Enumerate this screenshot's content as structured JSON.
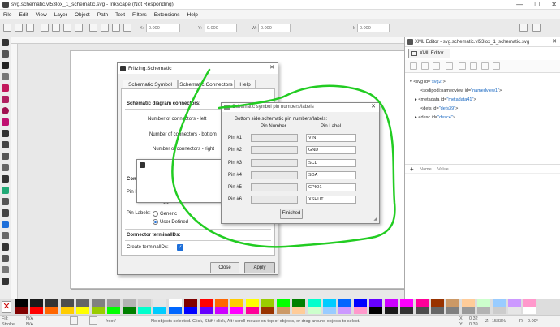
{
  "window": {
    "title": "svg.schematic.vl53lox_1_schematic.svg - Inkscape (Not Responding)",
    "controls": [
      "—",
      "☐",
      "✕"
    ]
  },
  "menu": [
    "File",
    "Edit",
    "View",
    "Layer",
    "Object",
    "Path",
    "Text",
    "Filters",
    "Extensions",
    "Help"
  ],
  "toolbar": {
    "x_label": "X:",
    "x_value": "0.000",
    "y_label": "Y:",
    "y_value": "0.000",
    "w_label": "W:",
    "w_value": "0.000",
    "h_label": "H:",
    "h_value": "0.000"
  },
  "xml_editor": {
    "window_title": "XML Editor - svg.schematic.vl53lox_1_schematic.svg",
    "tab_label": "XML Editor",
    "nodes": [
      {
        "prefix": "<svg id=",
        "value": "\"svg2\"",
        "suffix": ">"
      },
      {
        "prefix": "<sodipodi:namedview id=",
        "value": "\"namedview1\"",
        "suffix": ">"
      },
      {
        "prefix": "<metadata id=",
        "value": "\"metadata41\"",
        "suffix": ">"
      },
      {
        "prefix": "<defs id=",
        "value": "\"defs39\"",
        "suffix": ">"
      },
      {
        "prefix": "<desc id=",
        "value": "\"desc4\"",
        "suffix": ">"
      }
    ],
    "attr_add": "+",
    "attr_name_header": "Name",
    "attr_value_header": "Value"
  },
  "fritzing_dialog": {
    "title": "Fritzing:Schematic",
    "tabs": [
      "Schematic Symbol",
      "Schematic Connectors",
      "Help"
    ],
    "active_tab": 1,
    "section_connectors": "Schematic diagram connectors:",
    "num_left": "Number of connectors - left",
    "num_bottom": "Number of connectors - bottom",
    "num_right": "Number of connectors - right",
    "truncated_1": "Conn",
    "truncated_2": "Pin N",
    "user_defined_1": "User Defined",
    "pin_labels": "Pin Labels:",
    "generic": "Generic",
    "user_defined_2": "User Defined",
    "section_terminal": "Connector terminalIDs:",
    "create_terminal": "Create terminalIDs:",
    "close_btn": "Close",
    "apply_btn": "Apply"
  },
  "pin_dialog": {
    "title": "Schematic symbol pin numbers/labels",
    "heading": "Bottom side schematic pin numbers/labels:",
    "col_number": "Pin Number",
    "col_label": "Pin Label",
    "rows": [
      {
        "pin": "Pin #1",
        "label": "VIN"
      },
      {
        "pin": "Pin #2",
        "label": "GND"
      },
      {
        "pin": "Pin #3",
        "label": "SCL"
      },
      {
        "pin": "Pin #4",
        "label": "SDA"
      },
      {
        "pin": "Pin #5",
        "label": "CPIO1"
      },
      {
        "pin": "Pin #6",
        "label": "XSHUT"
      }
    ],
    "finished_btn": "Finished"
  },
  "status": {
    "fill_label": "Fill:",
    "fill_value": "N/A",
    "stroke_label": "Stroke:",
    "stroke_value": "N/A",
    "layer": "/root/",
    "message": "No objects selected. Click, Shift+click, Alt+scroll mouse on top of objects, or drag around objects to select.",
    "x_label": "X:",
    "x_value": "0.32",
    "y_label": "Y:",
    "y_value": "0.39",
    "zoom_label": "Z:",
    "zoom_value": "1583%",
    "rotation_label": "R:",
    "rotation_value": "0.00°"
  },
  "colors": {
    "accent": "#1e6fd9",
    "annotation": "#22cc22",
    "palette": [
      "#000000",
      "#1a1a1a",
      "#333333",
      "#4d4d4d",
      "#666666",
      "#808080",
      "#999999",
      "#b3b3b3",
      "#cccccc",
      "#e6e6e6",
      "#ffffff",
      "#800000",
      "#ff0000",
      "#ff6600",
      "#ffcc00",
      "#ffff00",
      "#99cc00",
      "#00ff00",
      "#008000",
      "#00ffcc",
      "#00ccff",
      "#0066ff",
      "#0000ff",
      "#6600ff",
      "#cc00ff",
      "#ff00ff",
      "#ff0099",
      "#993300",
      "#cc9966",
      "#ffcc99",
      "#ccffcc",
      "#99ccff",
      "#cc99ff",
      "#ff99cc"
    ]
  }
}
